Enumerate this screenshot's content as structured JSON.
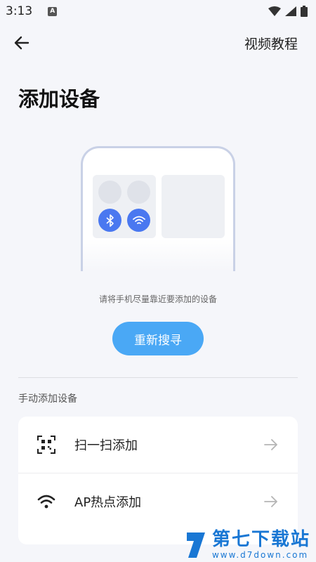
{
  "status_bar": {
    "time": "3:13",
    "notification_icon_letter": "A"
  },
  "header": {
    "back_icon": "arrow-left-icon",
    "tutorial_link": "视频教程"
  },
  "page": {
    "title": "添加设备"
  },
  "illustration": {
    "icons": [
      "bluetooth-icon",
      "wifi-icon"
    ],
    "accent": "#4a78f0"
  },
  "hint": "请将手机尽量靠近要添加的设备",
  "rescan_button": {
    "label": "重新搜寻",
    "color": "#4aa8f5"
  },
  "manual_section": {
    "label": "手动添加设备",
    "items": [
      {
        "icon": "qr-scan-icon",
        "label": "扫一扫添加"
      },
      {
        "icon": "wifi-icon",
        "label": "AP热点添加"
      }
    ]
  },
  "watermark": {
    "title": "第七下载站",
    "url": "www.d7down.com",
    "color": "#1977d4"
  }
}
